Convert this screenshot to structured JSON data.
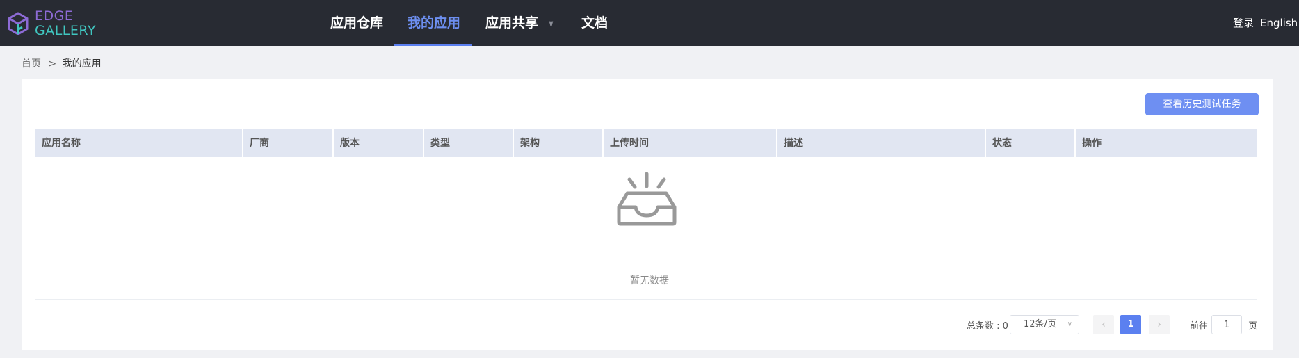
{
  "header": {
    "logo": {
      "line1": "EDGE",
      "line2": "GALLERY"
    },
    "nav": [
      {
        "label": "应用仓库"
      },
      {
        "label": "我的应用"
      },
      {
        "label": "应用共享"
      },
      {
        "label": "文档"
      }
    ],
    "login": "登录",
    "language": "English"
  },
  "breadcrumb": {
    "home": "首页",
    "separator": ">",
    "current": "我的应用"
  },
  "toolbar": {
    "history_button": "查看历史测试任务"
  },
  "table": {
    "columns": [
      "应用名称",
      "厂商",
      "版本",
      "类型",
      "架构",
      "上传时间",
      "描述",
      "状态",
      "操作"
    ],
    "rows": [],
    "empty_text": "暂无数据"
  },
  "pagination": {
    "total_label": "总条数 : 0",
    "page_size": "12条/页",
    "current_page": "1",
    "goto_label": "前往",
    "goto_value": "1",
    "page_suffix": "页"
  },
  "colors": {
    "header_bg": "#282b33",
    "accent": "#5b80f0",
    "table_header_bg": "#e1e6f2"
  }
}
